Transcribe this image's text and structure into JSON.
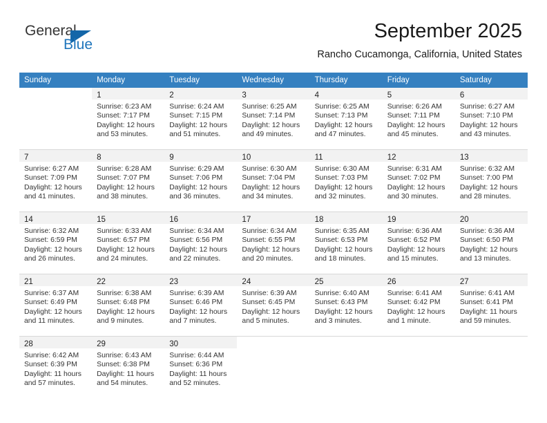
{
  "brand": {
    "name_primary": "General",
    "name_secondary": "Blue",
    "accent_color": "#1d74bb"
  },
  "header": {
    "month_title": "September 2025",
    "location": "Rancho Cucamonga, California, United States",
    "header_bg_color": "#3580c0"
  },
  "weekday_headers": [
    "Sunday",
    "Monday",
    "Tuesday",
    "Wednesday",
    "Thursday",
    "Friday",
    "Saturday"
  ],
  "weeks": [
    [
      {
        "day": "",
        "sunrise": "",
        "sunset": "",
        "daylight_line1": "",
        "daylight_line2": ""
      },
      {
        "day": "1",
        "sunrise": "Sunrise: 6:23 AM",
        "sunset": "Sunset: 7:17 PM",
        "daylight_line1": "Daylight: 12 hours",
        "daylight_line2": "and 53 minutes."
      },
      {
        "day": "2",
        "sunrise": "Sunrise: 6:24 AM",
        "sunset": "Sunset: 7:15 PM",
        "daylight_line1": "Daylight: 12 hours",
        "daylight_line2": "and 51 minutes."
      },
      {
        "day": "3",
        "sunrise": "Sunrise: 6:25 AM",
        "sunset": "Sunset: 7:14 PM",
        "daylight_line1": "Daylight: 12 hours",
        "daylight_line2": "and 49 minutes."
      },
      {
        "day": "4",
        "sunrise": "Sunrise: 6:25 AM",
        "sunset": "Sunset: 7:13 PM",
        "daylight_line1": "Daylight: 12 hours",
        "daylight_line2": "and 47 minutes."
      },
      {
        "day": "5",
        "sunrise": "Sunrise: 6:26 AM",
        "sunset": "Sunset: 7:11 PM",
        "daylight_line1": "Daylight: 12 hours",
        "daylight_line2": "and 45 minutes."
      },
      {
        "day": "6",
        "sunrise": "Sunrise: 6:27 AM",
        "sunset": "Sunset: 7:10 PM",
        "daylight_line1": "Daylight: 12 hours",
        "daylight_line2": "and 43 minutes."
      }
    ],
    [
      {
        "day": "7",
        "sunrise": "Sunrise: 6:27 AM",
        "sunset": "Sunset: 7:09 PM",
        "daylight_line1": "Daylight: 12 hours",
        "daylight_line2": "and 41 minutes."
      },
      {
        "day": "8",
        "sunrise": "Sunrise: 6:28 AM",
        "sunset": "Sunset: 7:07 PM",
        "daylight_line1": "Daylight: 12 hours",
        "daylight_line2": "and 38 minutes."
      },
      {
        "day": "9",
        "sunrise": "Sunrise: 6:29 AM",
        "sunset": "Sunset: 7:06 PM",
        "daylight_line1": "Daylight: 12 hours",
        "daylight_line2": "and 36 minutes."
      },
      {
        "day": "10",
        "sunrise": "Sunrise: 6:30 AM",
        "sunset": "Sunset: 7:04 PM",
        "daylight_line1": "Daylight: 12 hours",
        "daylight_line2": "and 34 minutes."
      },
      {
        "day": "11",
        "sunrise": "Sunrise: 6:30 AM",
        "sunset": "Sunset: 7:03 PM",
        "daylight_line1": "Daylight: 12 hours",
        "daylight_line2": "and 32 minutes."
      },
      {
        "day": "12",
        "sunrise": "Sunrise: 6:31 AM",
        "sunset": "Sunset: 7:02 PM",
        "daylight_line1": "Daylight: 12 hours",
        "daylight_line2": "and 30 minutes."
      },
      {
        "day": "13",
        "sunrise": "Sunrise: 6:32 AM",
        "sunset": "Sunset: 7:00 PM",
        "daylight_line1": "Daylight: 12 hours",
        "daylight_line2": "and 28 minutes."
      }
    ],
    [
      {
        "day": "14",
        "sunrise": "Sunrise: 6:32 AM",
        "sunset": "Sunset: 6:59 PM",
        "daylight_line1": "Daylight: 12 hours",
        "daylight_line2": "and 26 minutes."
      },
      {
        "day": "15",
        "sunrise": "Sunrise: 6:33 AM",
        "sunset": "Sunset: 6:57 PM",
        "daylight_line1": "Daylight: 12 hours",
        "daylight_line2": "and 24 minutes."
      },
      {
        "day": "16",
        "sunrise": "Sunrise: 6:34 AM",
        "sunset": "Sunset: 6:56 PM",
        "daylight_line1": "Daylight: 12 hours",
        "daylight_line2": "and 22 minutes."
      },
      {
        "day": "17",
        "sunrise": "Sunrise: 6:34 AM",
        "sunset": "Sunset: 6:55 PM",
        "daylight_line1": "Daylight: 12 hours",
        "daylight_line2": "and 20 minutes."
      },
      {
        "day": "18",
        "sunrise": "Sunrise: 6:35 AM",
        "sunset": "Sunset: 6:53 PM",
        "daylight_line1": "Daylight: 12 hours",
        "daylight_line2": "and 18 minutes."
      },
      {
        "day": "19",
        "sunrise": "Sunrise: 6:36 AM",
        "sunset": "Sunset: 6:52 PM",
        "daylight_line1": "Daylight: 12 hours",
        "daylight_line2": "and 15 minutes."
      },
      {
        "day": "20",
        "sunrise": "Sunrise: 6:36 AM",
        "sunset": "Sunset: 6:50 PM",
        "daylight_line1": "Daylight: 12 hours",
        "daylight_line2": "and 13 minutes."
      }
    ],
    [
      {
        "day": "21",
        "sunrise": "Sunrise: 6:37 AM",
        "sunset": "Sunset: 6:49 PM",
        "daylight_line1": "Daylight: 12 hours",
        "daylight_line2": "and 11 minutes."
      },
      {
        "day": "22",
        "sunrise": "Sunrise: 6:38 AM",
        "sunset": "Sunset: 6:48 PM",
        "daylight_line1": "Daylight: 12 hours",
        "daylight_line2": "and 9 minutes."
      },
      {
        "day": "23",
        "sunrise": "Sunrise: 6:39 AM",
        "sunset": "Sunset: 6:46 PM",
        "daylight_line1": "Daylight: 12 hours",
        "daylight_line2": "and 7 minutes."
      },
      {
        "day": "24",
        "sunrise": "Sunrise: 6:39 AM",
        "sunset": "Sunset: 6:45 PM",
        "daylight_line1": "Daylight: 12 hours",
        "daylight_line2": "and 5 minutes."
      },
      {
        "day": "25",
        "sunrise": "Sunrise: 6:40 AM",
        "sunset": "Sunset: 6:43 PM",
        "daylight_line1": "Daylight: 12 hours",
        "daylight_line2": "and 3 minutes."
      },
      {
        "day": "26",
        "sunrise": "Sunrise: 6:41 AM",
        "sunset": "Sunset: 6:42 PM",
        "daylight_line1": "Daylight: 12 hours",
        "daylight_line2": "and 1 minute."
      },
      {
        "day": "27",
        "sunrise": "Sunrise: 6:41 AM",
        "sunset": "Sunset: 6:41 PM",
        "daylight_line1": "Daylight: 11 hours",
        "daylight_line2": "and 59 minutes."
      }
    ],
    [
      {
        "day": "28",
        "sunrise": "Sunrise: 6:42 AM",
        "sunset": "Sunset: 6:39 PM",
        "daylight_line1": "Daylight: 11 hours",
        "daylight_line2": "and 57 minutes."
      },
      {
        "day": "29",
        "sunrise": "Sunrise: 6:43 AM",
        "sunset": "Sunset: 6:38 PM",
        "daylight_line1": "Daylight: 11 hours",
        "daylight_line2": "and 54 minutes."
      },
      {
        "day": "30",
        "sunrise": "Sunrise: 6:44 AM",
        "sunset": "Sunset: 6:36 PM",
        "daylight_line1": "Daylight: 11 hours",
        "daylight_line2": "and 52 minutes."
      },
      {
        "day": "",
        "sunrise": "",
        "sunset": "",
        "daylight_line1": "",
        "daylight_line2": ""
      },
      {
        "day": "",
        "sunrise": "",
        "sunset": "",
        "daylight_line1": "",
        "daylight_line2": ""
      },
      {
        "day": "",
        "sunrise": "",
        "sunset": "",
        "daylight_line1": "",
        "daylight_line2": ""
      },
      {
        "day": "",
        "sunrise": "",
        "sunset": "",
        "daylight_line1": "",
        "daylight_line2": ""
      }
    ]
  ]
}
